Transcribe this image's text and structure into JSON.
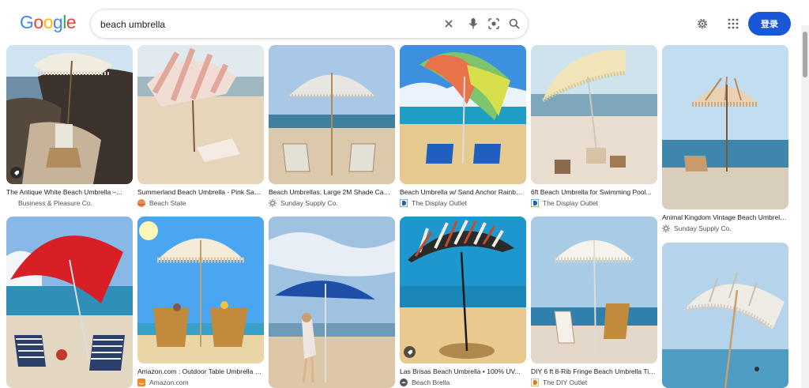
{
  "header": {
    "logo_text": "Google",
    "search_value": "beach umbrella",
    "signin_label": "登录",
    "icons": [
      "clear-icon",
      "mic-icon",
      "lens-icon",
      "search-icon",
      "settings-gear-icon",
      "apps-grid-icon"
    ]
  },
  "colors": {
    "brand_blue": "#4285F4",
    "brand_red": "#EA4335",
    "brand_yellow": "#FBBC05",
    "brand_green": "#34A853",
    "signin_bg": "#1a57d8"
  },
  "results": [
    {
      "title": "The Antique White Beach Umbrella –...",
      "source": "Business & Pleasure Co.",
      "favicon": "blank-favicon",
      "badge": "tag-icon"
    },
    {
      "title": "Summerland Beach Umbrella - Pink Salt...",
      "source": "Beach State",
      "favicon": "beach-state-favicon"
    },
    {
      "title": "Beach Umbrellas: Large 2M Shade Canop...",
      "source": "Sunday Supply Co.",
      "favicon": "sun-favicon"
    },
    {
      "title": "Beach Umbrella w/ Sand Anchor Rainbow...",
      "source": "The Display Outlet",
      "favicon": "display-outlet-favicon"
    },
    {
      "title": "6ft Beach Umbrella for Swimming Pool...",
      "source": "The Display Outlet",
      "favicon": "display-outlet-favicon"
    },
    {
      "title": "Animal Kingdom Vintage Beach Umbrella |...",
      "source": "Sunday Supply Co.",
      "favicon": "sun-favicon"
    },
    {
      "title": "",
      "source": "",
      "favicon": ""
    },
    {
      "title": "Amazon.com : Outdoor Table Umbrella 18...",
      "source": "Amazon.com",
      "favicon": "amazon-favicon"
    },
    {
      "title": "",
      "source": "",
      "favicon": ""
    },
    {
      "title": "Las Brisas Beach Umbrella • 100% UV...",
      "source": "Beach Brella",
      "favicon": "beach-brella-favicon",
      "badge": "tag-icon"
    },
    {
      "title": "DIY 6 ft 8-Rib Fringe Beach Umbrella Tilt...",
      "source": "The DIY Outlet",
      "favicon": "diy-outlet-favicon"
    },
    {
      "title": "",
      "source": "",
      "favicon": ""
    }
  ]
}
